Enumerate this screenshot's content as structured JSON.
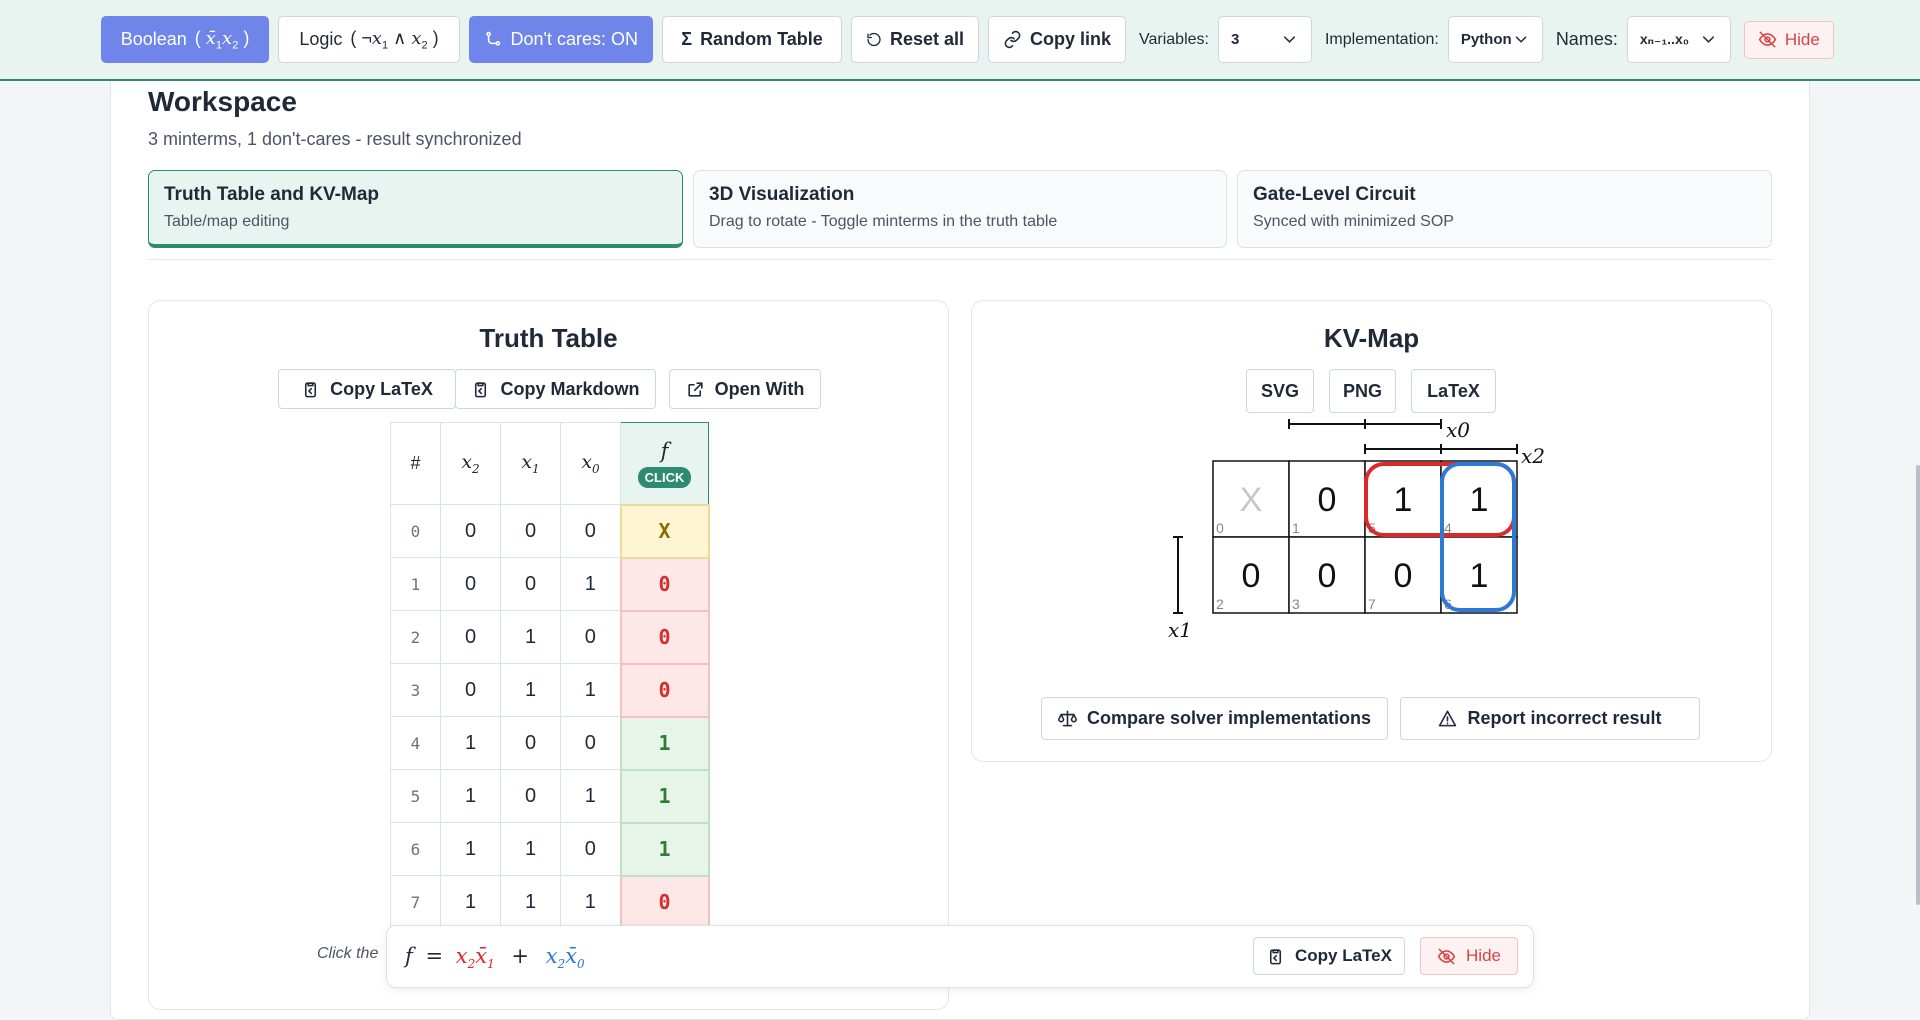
{
  "toolbar": {
    "boolean_label": "Boolean",
    "logic_label": "Logic",
    "dont_cares_label": "Don't cares: ON",
    "random_table_label": "Random Table",
    "reset_all_label": "Reset all",
    "copy_link_label": "Copy link",
    "variables_label": "Variables:",
    "variables_value": "3",
    "implementation_label": "Implementation:",
    "implementation_value": "Python",
    "names_label": "Names:",
    "names_value": "xₙ₋₁..x₀",
    "hide_label": "Hide"
  },
  "workspace": {
    "title": "Workspace",
    "subtitle": "3 minterms, 1 don't-cares - result synchronized",
    "tabs": [
      {
        "title": "Truth Table and KV-Map",
        "desc": "Table/map editing"
      },
      {
        "title": "3D Visualization",
        "desc": "Drag to rotate - Toggle minterms in the truth table"
      },
      {
        "title": "Gate-Level Circuit",
        "desc": "Synced with minimized SOP"
      }
    ]
  },
  "truth_table": {
    "title": "Truth Table",
    "copy_latex_label": "Copy LaTeX",
    "copy_markdown_label": "Copy Markdown",
    "open_with_label": "Open With",
    "headers": {
      "index": "#",
      "vars": [
        "x2",
        "x1",
        "x0"
      ],
      "f": "f",
      "click_badge": "CLICK"
    },
    "rows": [
      {
        "i": "0",
        "x2": "0",
        "x1": "0",
        "x0": "0",
        "f": "X"
      },
      {
        "i": "1",
        "x2": "0",
        "x1": "0",
        "x0": "1",
        "f": "0"
      },
      {
        "i": "2",
        "x2": "0",
        "x1": "1",
        "x0": "0",
        "f": "0"
      },
      {
        "i": "3",
        "x2": "0",
        "x1": "1",
        "x0": "1",
        "f": "0"
      },
      {
        "i": "4",
        "x2": "1",
        "x1": "0",
        "x0": "0",
        "f": "1"
      },
      {
        "i": "5",
        "x2": "1",
        "x1": "0",
        "x0": "1",
        "f": "1"
      },
      {
        "i": "6",
        "x2": "1",
        "x1": "1",
        "x0": "0",
        "f": "1"
      },
      {
        "i": "7",
        "x2": "1",
        "x1": "1",
        "x0": "1",
        "f": "0"
      }
    ],
    "hint_text": "Click the"
  },
  "kv_map": {
    "title": "KV-Map",
    "export": [
      "SVG",
      "PNG",
      "LaTeX"
    ],
    "var_labels": {
      "top": "x0",
      "top2": "x2",
      "left": "x1"
    },
    "cells": [
      [
        {
          "v": "X",
          "idx": "0"
        },
        {
          "v": "0",
          "idx": "1"
        },
        {
          "v": "1",
          "idx": "5"
        },
        {
          "v": "1",
          "idx": "4"
        }
      ],
      [
        {
          "v": "0",
          "idx": "2"
        },
        {
          "v": "0",
          "idx": "3"
        },
        {
          "v": "0",
          "idx": "7"
        },
        {
          "v": "1",
          "idx": "6"
        }
      ]
    ],
    "group_colors": {
      "red": "#e0282b",
      "blue": "#2c7ad6"
    },
    "compare_label": "Compare solver implementations",
    "report_label": "Report incorrect result"
  },
  "formula": {
    "copy_latex_label": "Copy LaTeX",
    "hide_label": "Hide"
  },
  "colors": {
    "accent": "#2e8b6e",
    "primary_button": "#6f85ea",
    "one": "#2e7d32",
    "zero": "#d32f2f"
  }
}
